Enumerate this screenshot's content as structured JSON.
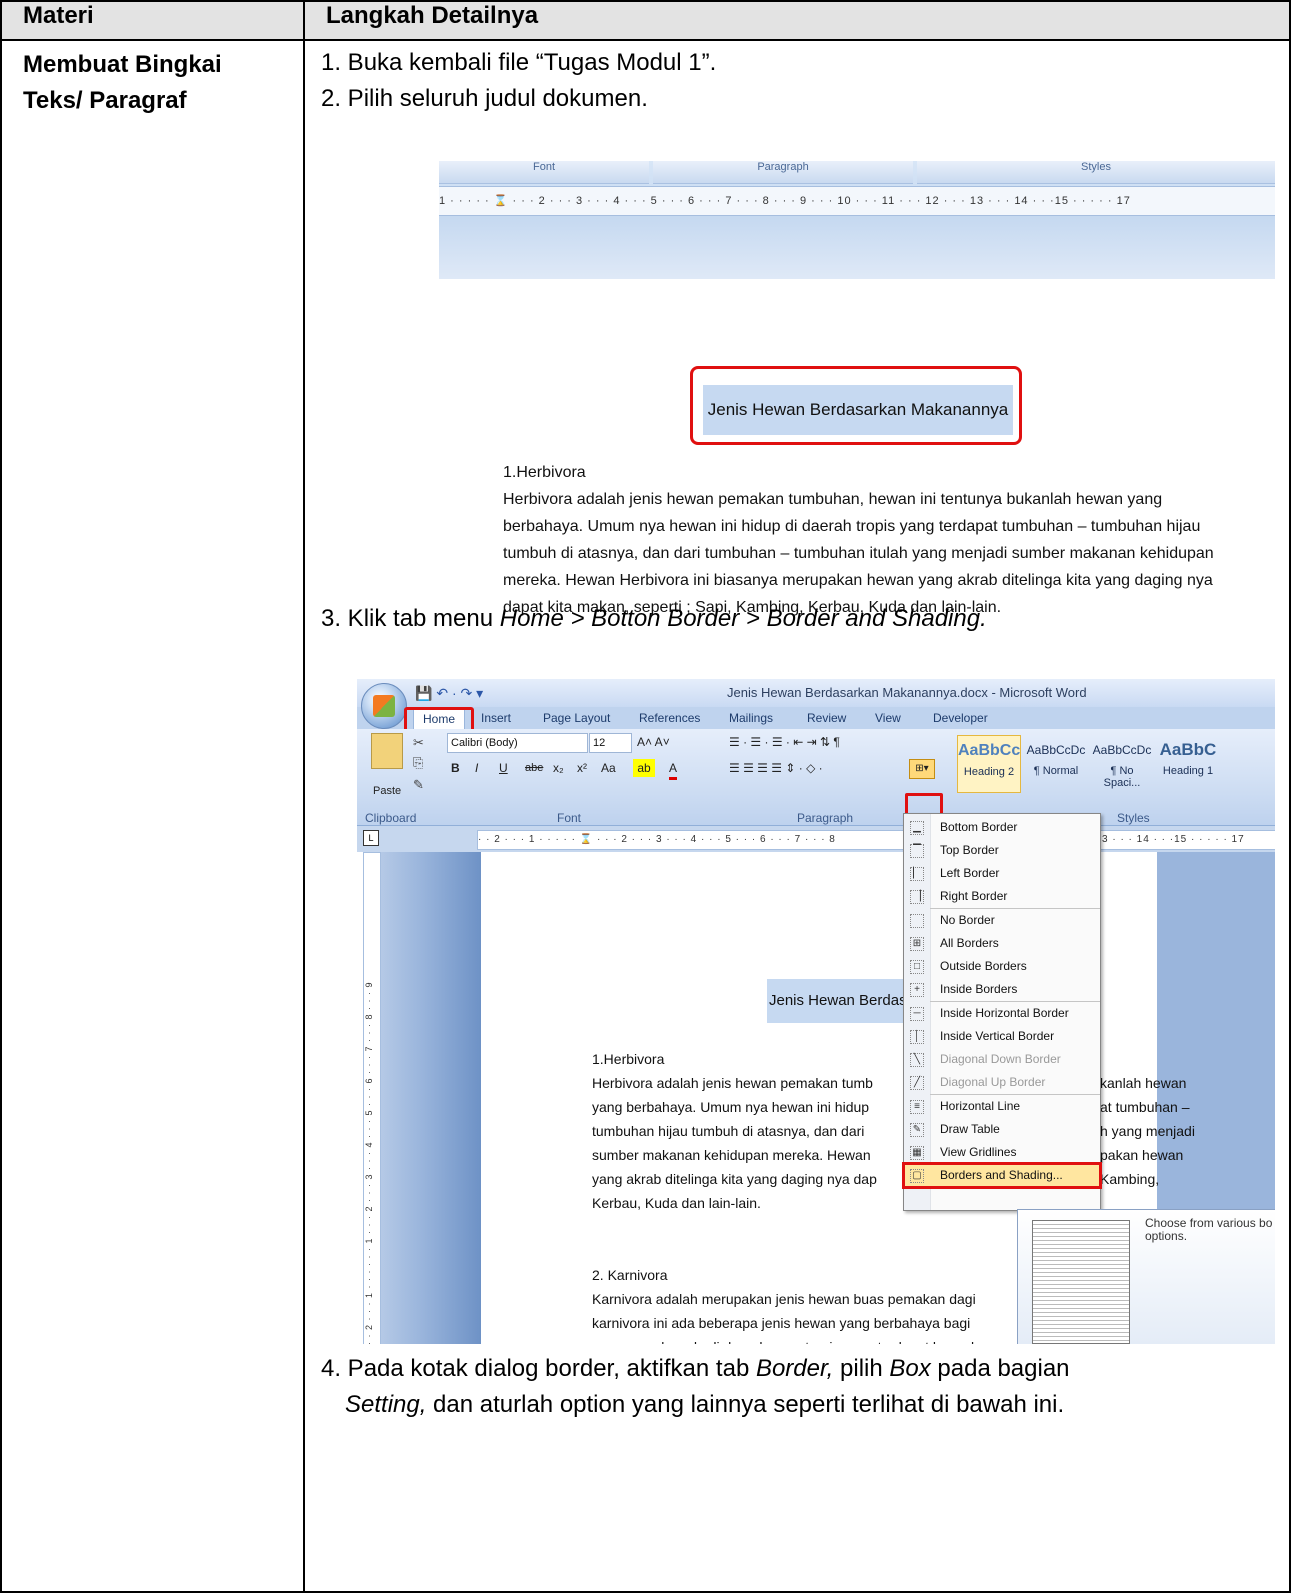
{
  "table": {
    "header_col1": "Materi",
    "header_col2": "Langkah Detailnya",
    "category_line1": "Membuat Bingkai",
    "category_line2": "Teks/ Paragraf"
  },
  "steps": {
    "step1": "1. Buka kembali file “Tugas Modul 1”.",
    "step2": "2. Pilih seluruh judul dokumen.",
    "step3_prefix": "3. Klik tab menu ",
    "step3_italic": "Home > Botton Border > Border and Shading.",
    "step4_a": "4. Pada kotak dialog border, aktifkan tab ",
    "step4_b": "Border,",
    "step4_c": " pilih ",
    "step4_d": "Box",
    "step4_e": " pada bagian ",
    "step4_f": "Setting,",
    "step4_g": " dan aturlah option yang lainnya seperti terlihat di bawah ini."
  },
  "shot1": {
    "ribbon_groups": [
      "Font",
      "Paragraph",
      "Styles"
    ],
    "ruler_text": "1 · · ·   · · ⌛ · · · 2 · · · 3 · · · 4 · · · 5 · · · 6 · · · 7 · · · 8 · · · 9 · · · 10 · · · 11 · · · 12 · · · 13 · · · 14 · · ·15 · · ·   · · 17",
    "doc_title": "Jenis Hewan Berdasarkan Makanannya",
    "heading": "1.Herbivora",
    "paragraph": "Herbivora adalah jenis hewan pemakan tumbuhan,  hewan ini tentunya bukanlah hewan yang berbahaya. Umum nya hewan ini hidup di daerah tropis yang terdapat tumbuhan – tumbuhan hijau tumbuh  di atasnya, dan dari tumbuhan – tumbuhan itulah yang menjadi sumber makanan kehidupan mereka. Hewan Herbivora ini biasanya merupakan hewan yang akrab ditelinga kita yang daging nya dapat kita makan, seperti ; Sapi, Kambing, Kerbau, Kuda dan lain-lain."
  },
  "shot2": {
    "window_title": "Jenis Hewan Berdasarkan Makanannya.docx - Microsoft Word",
    "tabs": [
      "Home",
      "Insert",
      "Page Layout",
      "References",
      "Mailings",
      "Review",
      "View",
      "Developer"
    ],
    "font_name": "Calibri (Body)",
    "font_size": "12",
    "paste_label": "Paste",
    "groups": [
      "Clipboard",
      "Font",
      "Paragraph",
      "Styles"
    ],
    "styles": [
      {
        "sample": "AaBbCc",
        "name": "Heading 2"
      },
      {
        "sample": "AaBbCcDc",
        "name": "¶ Normal"
      },
      {
        "sample": "AaBbCcDc",
        "name": "¶ No Spaci..."
      },
      {
        "sample": "AaBbC",
        "name": "Heading 1"
      }
    ],
    "ruler_text": "· · 2 · · · 1 · · ·   · · ⌛ · · · 2 · · · 3 · · · 4 · · · 5 · · · 6 · · · 7 · · · 8",
    "ruler_text_right": "3 · · · 14 · · ·15 · · ·   · · 17",
    "vruler_text": "· · 2 · · · 1 · · ·   · · · 1 · · · 2 · · · 3 · · · 4 · · · 5 · · · 6 · · · 7 · · · 8 · · · 9",
    "doc_title_partial": "Jenis Hewan Berdas",
    "herb_heading": "1.Herbivora",
    "herb_lines_left": [
      "Herbivora adalah jenis hewan pemakan tumb",
      "yang berbahaya. Umum nya hewan ini hidup",
      "tumbuhan hijau tumbuh  di atasnya, dan dari",
      "sumber makanan kehidupan mereka. Hewan",
      "yang akrab ditelinga kita yang daging nya dap",
      "Kerbau, Kuda dan lain-lain."
    ],
    "herb_lines_right": [
      "kanlah hewan",
      "at tumbuhan –",
      "h yang menjadi",
      "pakan hewan",
      "Kambing,",
      ""
    ],
    "karn_heading": "2. Karnivora",
    "karn_lines": [
      "Karnivora adalah merupakan jenis hewan buas pemakan dagi",
      "karnivora ini ada beberapa jenis hewan yang berbahaya bagi",
      "umum nya berada di daerah yang tropis yang terdapat banyak"
    ],
    "menu_items": [
      {
        "label": "Bottom Border",
        "icon": "bottom-border-icon",
        "glyph": "▁",
        "disabled": false
      },
      {
        "label": "Top Border",
        "icon": "top-border-icon",
        "glyph": "▔",
        "disabled": false
      },
      {
        "label": "Left Border",
        "icon": "left-border-icon",
        "glyph": "▏",
        "disabled": false
      },
      {
        "label": "Right Border",
        "icon": "right-border-icon",
        "glyph": "▕",
        "disabled": false
      },
      {
        "label": "No Border",
        "icon": "no-border-icon",
        "glyph": "",
        "disabled": false
      },
      {
        "label": "All Borders",
        "icon": "all-borders-icon",
        "glyph": "⊞",
        "disabled": false
      },
      {
        "label": "Outside Borders",
        "icon": "outside-borders-icon",
        "glyph": "□",
        "disabled": false
      },
      {
        "label": "Inside Borders",
        "icon": "inside-borders-icon",
        "glyph": "+",
        "disabled": false
      },
      {
        "label": "Inside Horizontal Border",
        "icon": "inside-horizontal-border-icon",
        "glyph": "─",
        "disabled": false
      },
      {
        "label": "Inside Vertical Border",
        "icon": "inside-vertical-border-icon",
        "glyph": "│",
        "disabled": false
      },
      {
        "label": "Diagonal Down Border",
        "icon": "diagonal-down-border-icon",
        "glyph": "╲",
        "disabled": true
      },
      {
        "label": "Diagonal Up Border",
        "icon": "diagonal-up-border-icon",
        "glyph": "╱",
        "disabled": true
      },
      {
        "label": "Horizontal Line",
        "icon": "horizontal-line-icon",
        "glyph": "≡",
        "disabled": false
      },
      {
        "label": "Draw Table",
        "icon": "draw-table-icon",
        "glyph": "✎",
        "disabled": false
      },
      {
        "label": "View Gridlines",
        "icon": "view-gridlines-icon",
        "glyph": "▦",
        "disabled": false
      },
      {
        "label": "Borders and Shading...",
        "icon": "borders-and-shading-icon",
        "glyph": "▢",
        "disabled": false
      }
    ],
    "tooltip_text": "Choose from various bo options."
  }
}
